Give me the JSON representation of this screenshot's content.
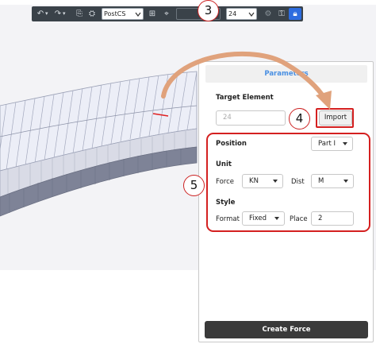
{
  "toolbar": {
    "coordinate_system": "PostCS",
    "size_value": "24"
  },
  "callouts": {
    "c3": "3",
    "c4": "4",
    "c5": "5"
  },
  "panel": {
    "header": "Parameters",
    "target_element_label": "Target Element",
    "target_element_value": "24",
    "import_label": "Import",
    "position_label": "Position",
    "position_value": "Part I",
    "unit_label": "Unit",
    "force_label": "Force",
    "force_value": "KN",
    "dist_label": "Dist",
    "dist_value": "M",
    "style_label": "Style",
    "format_label": "Format",
    "format_value": "Fixed",
    "place_label": "Place",
    "place_value": "2",
    "create_label": "Create Force"
  },
  "colors": {
    "highlight": "#d42020",
    "header_text": "#4a90e2",
    "toolbar_bg": "#3a4249",
    "arrow": "#e0a27c"
  }
}
